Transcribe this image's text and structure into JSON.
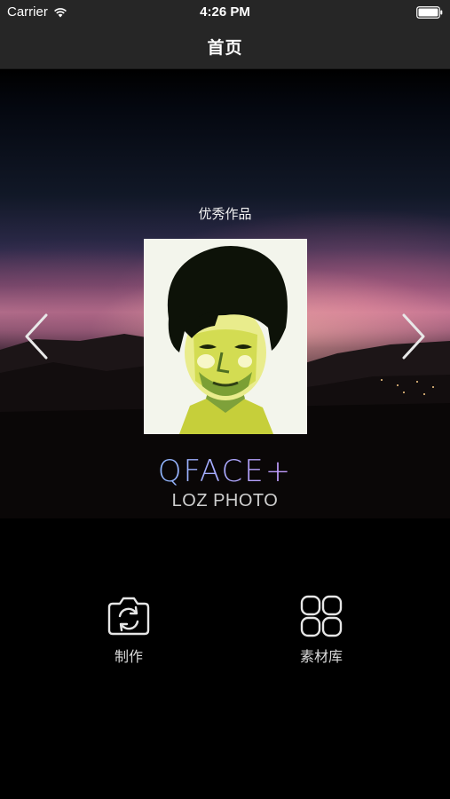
{
  "status_bar": {
    "carrier": "Carrier",
    "time": "4:26 PM",
    "wifi_icon": "wifi-icon",
    "battery_icon": "battery-icon"
  },
  "nav": {
    "title": "首页"
  },
  "hero": {
    "label": "优秀作品",
    "prev_icon": "chevron-left-icon",
    "next_icon": "chevron-right-icon",
    "logo_main": "QFACE+",
    "logo_sub": "LOZ PHOTO"
  },
  "actions": [
    {
      "label": "制作",
      "icon": "camera-refresh-icon"
    },
    {
      "label": "素材库",
      "icon": "grid-icon"
    }
  ],
  "colors": {
    "bar_background": "#262626",
    "page_background": "#000000",
    "logo_gradient_start": "#7fd3ff",
    "logo_gradient_end": "#d68cf0"
  }
}
